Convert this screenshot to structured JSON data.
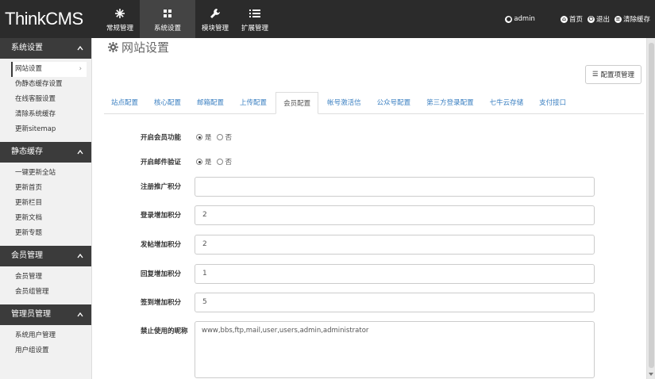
{
  "brand": "ThinkCMS",
  "topnav": [
    {
      "label": "常规管理",
      "icon": "asterisk-icon"
    },
    {
      "label": "系统设置",
      "icon": "grid-icon"
    },
    {
      "label": "模块管理",
      "icon": "wrench-icon"
    },
    {
      "label": "扩展管理",
      "icon": "list-icon"
    }
  ],
  "topright": {
    "user": "admin",
    "home": "首页",
    "logout": "退出",
    "clear_cache": "清除缓存"
  },
  "sidebar": [
    {
      "title": "系统设置",
      "items": [
        "网站设置",
        "伪静态缓存设置",
        "在线客服设置",
        "清除系统缓存",
        "更新sitemap"
      ]
    },
    {
      "title": "静态缓存",
      "items": [
        "一键更新全站",
        "更新首页",
        "更新栏目",
        "更新文档",
        "更新专题"
      ]
    },
    {
      "title": "会员管理",
      "items": [
        "会员管理",
        "会员组管理"
      ]
    },
    {
      "title": "管理员管理",
      "items": [
        "系统用户管理",
        "用户组设置"
      ]
    }
  ],
  "page_title": "网站设置",
  "config_button": "配置项管理",
  "tabs": [
    "站点配置",
    "核心配置",
    "邮箱配置",
    "上传配置",
    "会员配置",
    "帐号激活信",
    "公众号配置",
    "第三方登录配置",
    "七牛云存储",
    "支付接口"
  ],
  "active_tab": "会员配置",
  "form": {
    "member_enabled": {
      "label": "开启会员功能",
      "yes": "是",
      "no": "否"
    },
    "email_verify": {
      "label": "开启邮件验证",
      "yes": "是",
      "no": "否"
    },
    "register_label": "注册推广积分",
    "register_value": "",
    "login_label": "登录增加积分",
    "login_value": "2",
    "post_label": "发帖增加积分",
    "post_value": "2",
    "reply_label": "回复增加积分",
    "reply_value": "1",
    "signin_label": "签到增加积分",
    "signin_value": "5",
    "banned_label": "禁止使用的昵称",
    "banned_value": "www,bbs,ftp,mail,user,users,admin,administrator"
  }
}
